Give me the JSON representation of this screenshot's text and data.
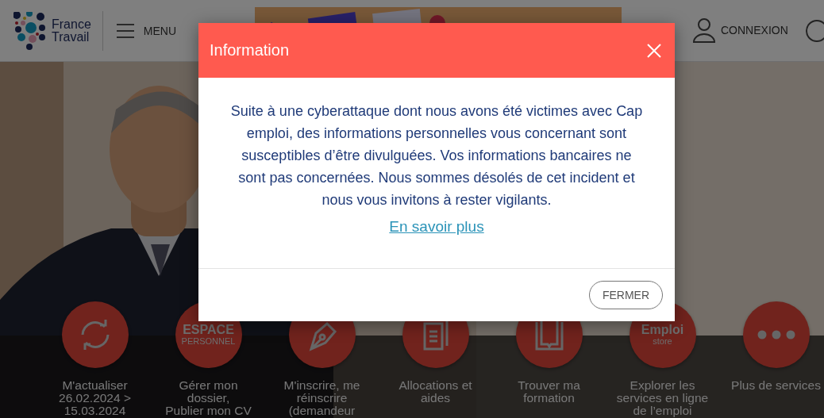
{
  "header": {
    "logo_text": "France\nTravail",
    "menu_label": "MENU",
    "login_label": "CONNEXION"
  },
  "services": [
    {
      "kind": "refresh",
      "label": "M'actualiser\n26.02.2024 >\n15.03.2024"
    },
    {
      "kind": "text",
      "icon_text": "ESPACE",
      "icon_subtext": "PERSONNEL",
      "label": "Gérer mon\ndossier,\nPublier mon CV"
    },
    {
      "kind": "pen",
      "label": "M'inscrire, me\nréinscrire\n(demandeur"
    },
    {
      "kind": "document",
      "label": "Allocations et\naides"
    },
    {
      "kind": "book",
      "label": "Trouver ma\nformation"
    },
    {
      "kind": "text",
      "icon_text": "Emploi",
      "icon_subtext": "store",
      "label": "Explorer les\nservices en ligne\nde l’emploi"
    },
    {
      "kind": "dots",
      "label": "Plus de services"
    }
  ],
  "dialog": {
    "title": "Information",
    "message": "Suite à une cyberattaque dont nous avons été victimes avec Cap emploi, des informations personnelles vous concernant sont susceptibles d’être divulguées. Vos informations bancaires ne sont pas concernées. Nous sommes désolés de cet incident et nous vous invitons à rester vigilants.",
    "link": "En savoir plus",
    "close_button": "FERMER"
  }
}
